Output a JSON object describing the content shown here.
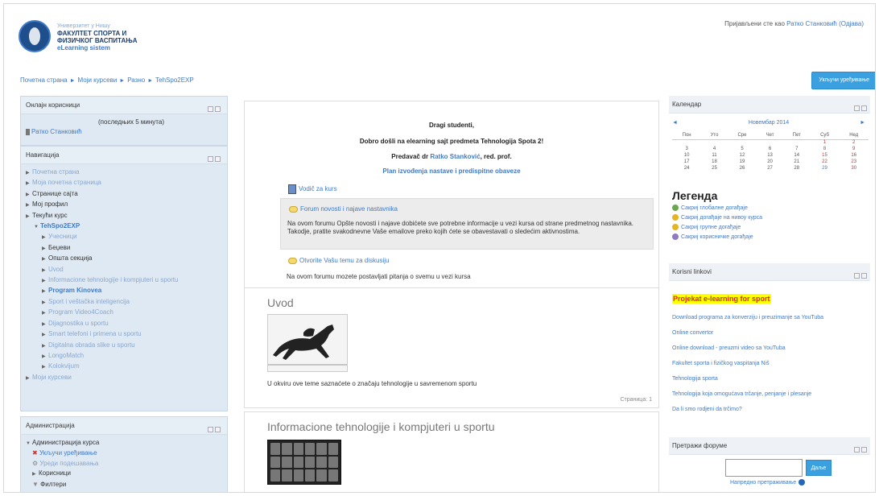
{
  "header": {
    "logo_line0": "Универзитет у Нишу",
    "logo_line1": "ФАКУЛТЕТ СПОРТА И",
    "logo_line2": "ФИЗИЧКОГ ВАСПИТАЊА",
    "logo_line3": "eLearning sistem",
    "login_prefix": "Пријављени сте као",
    "login_user": "Ратко Станковић",
    "logout": "(Одјава)"
  },
  "breadcrumb": [
    "Почетна страна",
    "Моји курсеви",
    "Разно",
    "TehSpo2EXP"
  ],
  "edit_button": "Укључи уређивање",
  "online_users": {
    "title": "Онлајн корисници",
    "period": "(последњих 5 минута)",
    "user": "Ратко Станковић"
  },
  "navigation": {
    "title": "Навигација",
    "items": [
      {
        "label": "Почетна страна",
        "indent": 0,
        "style": "muted"
      },
      {
        "label": "Моја почетна страница",
        "indent": 0,
        "style": "muted"
      },
      {
        "label": "Странице сајта",
        "indent": 0,
        "style": "dark"
      },
      {
        "label": "Мој профил",
        "indent": 0,
        "style": "dark"
      },
      {
        "label": "Текући курс",
        "indent": 0,
        "style": "dark"
      },
      {
        "label": "TehSpo2EXP",
        "indent": 1,
        "style": "bold"
      },
      {
        "label": "Учесници",
        "indent": 2,
        "style": "muted"
      },
      {
        "label": "Беџеви",
        "indent": 2,
        "style": "dark"
      },
      {
        "label": "Општа секција",
        "indent": 2,
        "style": "dark"
      },
      {
        "label": "Uvod",
        "indent": 2,
        "style": "muted"
      },
      {
        "label": "Informacione tehnologije i kompjuteri u sportu",
        "indent": 2,
        "style": "muted"
      },
      {
        "label": "Program Kinovea",
        "indent": 2,
        "style": "bold"
      },
      {
        "label": "Sport i veštačka inteligencija",
        "indent": 2,
        "style": "muted"
      },
      {
        "label": "Program Video4Coach",
        "indent": 2,
        "style": "muted"
      },
      {
        "label": "Dijagnostika u sportu",
        "indent": 2,
        "style": "muted"
      },
      {
        "label": "Smart telefoni i primena u sportu",
        "indent": 2,
        "style": "muted"
      },
      {
        "label": "Digitalna obrada slike u sportu",
        "indent": 2,
        "style": "muted"
      },
      {
        "label": "LongoMatch",
        "indent": 2,
        "style": "muted"
      },
      {
        "label": "Kolokvijum",
        "indent": 2,
        "style": "muted"
      },
      {
        "label": "Моји курсеви",
        "indent": 0,
        "style": "muted"
      }
    ]
  },
  "administration": {
    "title": "Администрација",
    "items": [
      "Администрација курса",
      "Укључи уређивање",
      "Уреди подешавања",
      "Корисници",
      "Филтери"
    ]
  },
  "intro": {
    "greet": "Dragi studenti,",
    "welcome": "Dobro došli na elearning sajt predmeta Tehnologija Spota 2!",
    "lecturer_prefix": "Predavač dr",
    "lecturer_name": "Ratko Stanković",
    "lecturer_suffix": ", red. prof.",
    "plan": "Plan izvođenja nastave i predispitne obaveze",
    "guide": "Vodič za kurs",
    "forum_title": "Forum novosti i najave nastavnika",
    "forum_desc": "Na ovom forumu Opšte novosti i najave dobićete sve potrebne informacije u vezi kursa od strane predmetnog nastavnika. Takodje, pratite svakodnevne Vaše emailove preko kojih ćete se obavestavati o sledećim aktivnostima.",
    "discuss": "Otvorite Vašu temu za diskusiju",
    "discuss_desc": "Na ovom forumu  mozete postavljati pitanja o svemu u vezi kursa"
  },
  "section1": {
    "title": "Uvod",
    "desc": "U okviru ove teme saznaćete o značaju tehnologije u savremenom sportu",
    "page": "Страница: 1"
  },
  "section2": {
    "title": "Informacione tehnologije i kompjuteri u sportu"
  },
  "calendar": {
    "title": "Календар",
    "month": "Новембар 2014",
    "prev": "◄",
    "next": "►",
    "days": [
      "Пон",
      "Уто",
      "Сре",
      "Чет",
      "Пет",
      "Суб",
      "Нед"
    ],
    "weeks": [
      [
        "",
        "",
        "",
        "",
        "",
        "1",
        "2"
      ],
      [
        "3",
        "4",
        "5",
        "6",
        "7",
        "8",
        "9"
      ],
      [
        "10",
        "11",
        "12",
        "13",
        "14",
        "15",
        "16"
      ],
      [
        "17",
        "18",
        "19",
        "20",
        "21",
        "22",
        "23"
      ],
      [
        "24",
        "25",
        "26",
        "27",
        "28",
        "29",
        "30"
      ]
    ],
    "today": "29"
  },
  "legend": {
    "title": "Легенда",
    "items": [
      {
        "label": "Сакриј глобалне догађаје",
        "color": "#6aa84f"
      },
      {
        "label": "Сакриј догађаје на нивоу курса",
        "color": "#e6b422"
      },
      {
        "label": "Сакриј групне догађаје",
        "color": "#e6b422"
      },
      {
        "label": "Сакриј корисничке догађаје",
        "color": "#8e7cc3"
      }
    ]
  },
  "links": {
    "title": "Korisni linkovi",
    "highlight": "Projekat e-learning for sport",
    "items": [
      "Download programa za konverziju i preuzimanje sa YouTuba",
      "Online convertor",
      "Online download - preuzmi video sa YouTuba",
      "Fakultet sporta i fizičkog vaspitanja Niš",
      "Tehnologija sporta",
      "Tehnologija koja omogućava trčanje, penjanje i plesanje",
      "Da li smo rodjeni da trčimo?"
    ]
  },
  "search": {
    "title": "Претражи форуме",
    "button": "Даље",
    "advanced": "Напредно претраживање"
  },
  "colors": {
    "accent": "#3f7ac9",
    "button": "#3aa0e0",
    "block_bg": "#dfe9f3"
  }
}
